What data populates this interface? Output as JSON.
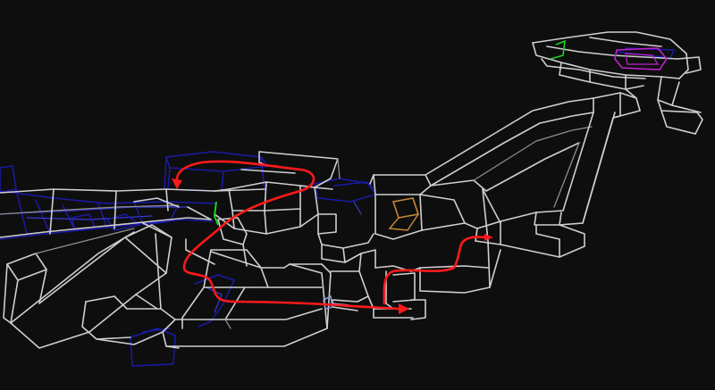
{
  "scene": {
    "background": "#0e0e0e",
    "wireframe_color": "#cfcfcf",
    "wireframe_dim_color": "#8e8e8e",
    "navmesh_color": "#1a1aa8",
    "path_color": "#ff1a1a",
    "spawn_color": "#22cc22",
    "goal_color": "#c020d0",
    "marker_color": "#c8893a",
    "waypoint_color": "#8a9ad8"
  }
}
